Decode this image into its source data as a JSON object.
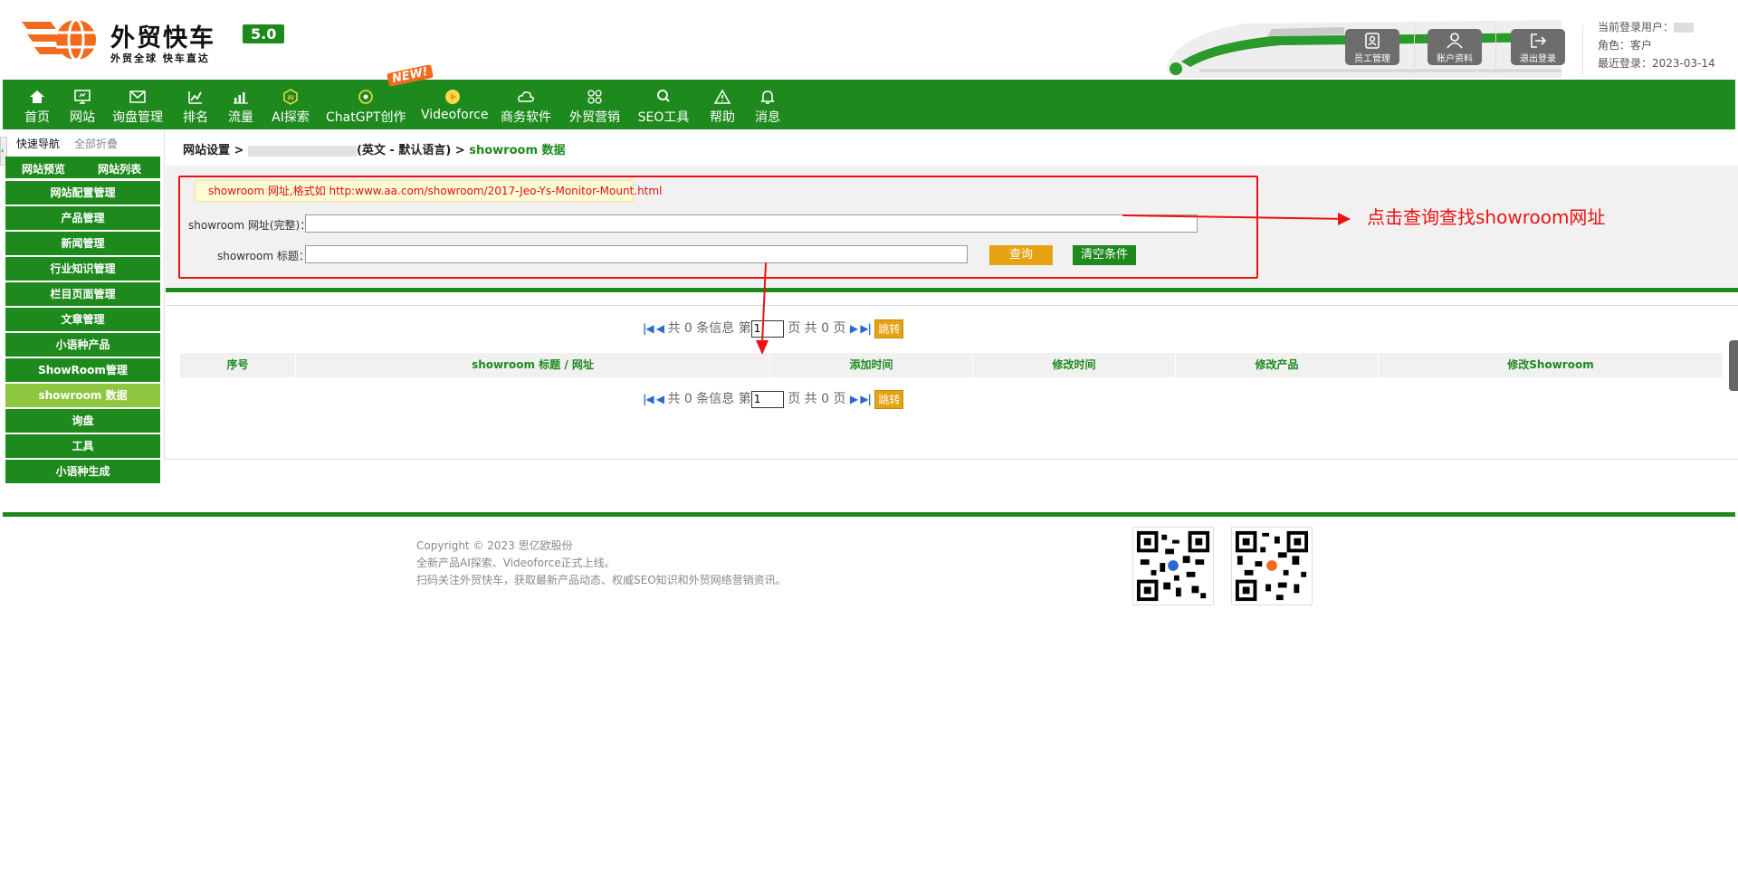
{
  "logo": {
    "title": "外贸快车",
    "subtitle": "外贸全球 快车直达",
    "version": "5.0"
  },
  "header": {
    "buttons": [
      {
        "label": "员工管理",
        "icon": "staff-icon"
      },
      {
        "label": "账户资料",
        "icon": "account-icon"
      },
      {
        "label": "退出登录",
        "icon": "logout-icon"
      }
    ],
    "user": {
      "current_user_label": "当前登录用户：",
      "role_label": "角色：",
      "role_value": "客户",
      "last_login_label": "最近登录：",
      "last_login_value": "2023-03-14"
    }
  },
  "nav": {
    "new_badge": "NEW!",
    "items": [
      {
        "label": "首页",
        "icon": "home-icon"
      },
      {
        "label": "网站",
        "icon": "monitor-icon"
      },
      {
        "label": "询盘管理",
        "icon": "mail-icon"
      },
      {
        "label": "排名",
        "icon": "ranking-icon"
      },
      {
        "label": "流量",
        "icon": "bar-chart-icon"
      },
      {
        "label": "AI探索",
        "icon": "ai-icon"
      },
      {
        "label": "ChatGPT创作",
        "icon": "chatgpt-icon"
      },
      {
        "label": "Videoforce",
        "icon": "video-icon"
      },
      {
        "label": "商务软件",
        "icon": "cloud-icon"
      },
      {
        "label": "外贸营销",
        "icon": "marketing-icon"
      },
      {
        "label": "SEO工具",
        "icon": "search-icon"
      },
      {
        "label": "帮助",
        "icon": "warning-icon"
      },
      {
        "label": "消息",
        "icon": "bell-icon"
      }
    ]
  },
  "sidebar": {
    "quick_nav": "快速导航",
    "collapse_all": "全部折叠",
    "preview": "网站预览",
    "site_list": "网站列表",
    "items": [
      {
        "label": "网站配置管理",
        "active": false
      },
      {
        "label": "产品管理",
        "active": false
      },
      {
        "label": "新闻管理",
        "active": false
      },
      {
        "label": "行业知识管理",
        "active": false
      },
      {
        "label": "栏目页面管理",
        "active": false
      },
      {
        "label": "文章管理",
        "active": false
      },
      {
        "label": "小语种产品",
        "active": false
      },
      {
        "label": "ShowRoom管理",
        "active": false
      },
      {
        "label": "showroom 数据",
        "active": true
      },
      {
        "label": "询盘",
        "active": false
      },
      {
        "label": "工具",
        "active": false
      },
      {
        "label": "小语种生成",
        "active": false
      }
    ]
  },
  "breadcrumb": {
    "root": "网站设置 >",
    "lang": "(英文 - 默认语言) >",
    "current": "showroom 数据"
  },
  "search": {
    "hint": "showroom 网址,格式如 http:www.aa.com/showroom/2017-Jeo-Ys-Monitor-Mount.html",
    "url_label": "showroom 网址(完整)：",
    "url_value": "",
    "title_label": "showroom 标题：",
    "title_value": "",
    "query_button": "查询",
    "clear_button": "清空条件"
  },
  "pager": {
    "prefix": "共 0 条信息 第",
    "page_value": "1",
    "suffix": "页 共 0 页",
    "jump_button": "跳转"
  },
  "table": {
    "columns": [
      "序号",
      "showroom 标题 / 网址",
      "添加时间",
      "修改时间",
      "修改产品",
      "修改Showroom"
    ]
  },
  "annotation": {
    "text": "点击查询查找showroom网址",
    "color": "#ee1111"
  },
  "footer": {
    "copyright": "Copyright © 2023 思亿欧股份",
    "line2": "全新产品AI探索、Videoforce正式上线。",
    "line3": "扫码关注外贸快车，获取最新产品动态、权威SEO知识和外贸网络营销资讯。"
  },
  "colors": {
    "brand_green": "#1e8a1e",
    "active_green": "#8dc63f",
    "accent_orange": "#e5a212",
    "annotation_red": "#ee1111"
  }
}
